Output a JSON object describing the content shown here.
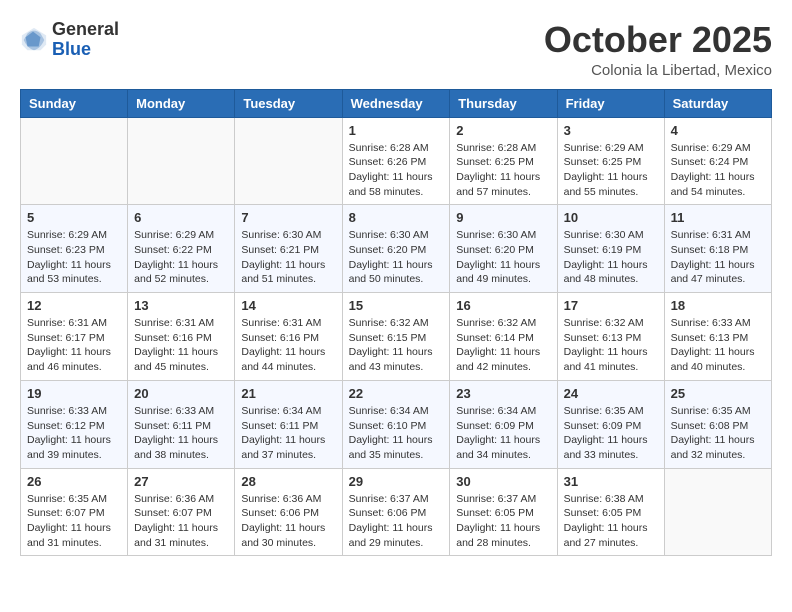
{
  "header": {
    "logo_general": "General",
    "logo_blue": "Blue",
    "month_title": "October 2025",
    "subtitle": "Colonia la Libertad, Mexico"
  },
  "days_of_week": [
    "Sunday",
    "Monday",
    "Tuesday",
    "Wednesday",
    "Thursday",
    "Friday",
    "Saturday"
  ],
  "weeks": [
    [
      {
        "day": "",
        "info": ""
      },
      {
        "day": "",
        "info": ""
      },
      {
        "day": "",
        "info": ""
      },
      {
        "day": "1",
        "info": "Sunrise: 6:28 AM\nSunset: 6:26 PM\nDaylight: 11 hours\nand 58 minutes."
      },
      {
        "day": "2",
        "info": "Sunrise: 6:28 AM\nSunset: 6:25 PM\nDaylight: 11 hours\nand 57 minutes."
      },
      {
        "day": "3",
        "info": "Sunrise: 6:29 AM\nSunset: 6:25 PM\nDaylight: 11 hours\nand 55 minutes."
      },
      {
        "day": "4",
        "info": "Sunrise: 6:29 AM\nSunset: 6:24 PM\nDaylight: 11 hours\nand 54 minutes."
      }
    ],
    [
      {
        "day": "5",
        "info": "Sunrise: 6:29 AM\nSunset: 6:23 PM\nDaylight: 11 hours\nand 53 minutes."
      },
      {
        "day": "6",
        "info": "Sunrise: 6:29 AM\nSunset: 6:22 PM\nDaylight: 11 hours\nand 52 minutes."
      },
      {
        "day": "7",
        "info": "Sunrise: 6:30 AM\nSunset: 6:21 PM\nDaylight: 11 hours\nand 51 minutes."
      },
      {
        "day": "8",
        "info": "Sunrise: 6:30 AM\nSunset: 6:20 PM\nDaylight: 11 hours\nand 50 minutes."
      },
      {
        "day": "9",
        "info": "Sunrise: 6:30 AM\nSunset: 6:20 PM\nDaylight: 11 hours\nand 49 minutes."
      },
      {
        "day": "10",
        "info": "Sunrise: 6:30 AM\nSunset: 6:19 PM\nDaylight: 11 hours\nand 48 minutes."
      },
      {
        "day": "11",
        "info": "Sunrise: 6:31 AM\nSunset: 6:18 PM\nDaylight: 11 hours\nand 47 minutes."
      }
    ],
    [
      {
        "day": "12",
        "info": "Sunrise: 6:31 AM\nSunset: 6:17 PM\nDaylight: 11 hours\nand 46 minutes."
      },
      {
        "day": "13",
        "info": "Sunrise: 6:31 AM\nSunset: 6:16 PM\nDaylight: 11 hours\nand 45 minutes."
      },
      {
        "day": "14",
        "info": "Sunrise: 6:31 AM\nSunset: 6:16 PM\nDaylight: 11 hours\nand 44 minutes."
      },
      {
        "day": "15",
        "info": "Sunrise: 6:32 AM\nSunset: 6:15 PM\nDaylight: 11 hours\nand 43 minutes."
      },
      {
        "day": "16",
        "info": "Sunrise: 6:32 AM\nSunset: 6:14 PM\nDaylight: 11 hours\nand 42 minutes."
      },
      {
        "day": "17",
        "info": "Sunrise: 6:32 AM\nSunset: 6:13 PM\nDaylight: 11 hours\nand 41 minutes."
      },
      {
        "day": "18",
        "info": "Sunrise: 6:33 AM\nSunset: 6:13 PM\nDaylight: 11 hours\nand 40 minutes."
      }
    ],
    [
      {
        "day": "19",
        "info": "Sunrise: 6:33 AM\nSunset: 6:12 PM\nDaylight: 11 hours\nand 39 minutes."
      },
      {
        "day": "20",
        "info": "Sunrise: 6:33 AM\nSunset: 6:11 PM\nDaylight: 11 hours\nand 38 minutes."
      },
      {
        "day": "21",
        "info": "Sunrise: 6:34 AM\nSunset: 6:11 PM\nDaylight: 11 hours\nand 37 minutes."
      },
      {
        "day": "22",
        "info": "Sunrise: 6:34 AM\nSunset: 6:10 PM\nDaylight: 11 hours\nand 35 minutes."
      },
      {
        "day": "23",
        "info": "Sunrise: 6:34 AM\nSunset: 6:09 PM\nDaylight: 11 hours\nand 34 minutes."
      },
      {
        "day": "24",
        "info": "Sunrise: 6:35 AM\nSunset: 6:09 PM\nDaylight: 11 hours\nand 33 minutes."
      },
      {
        "day": "25",
        "info": "Sunrise: 6:35 AM\nSunset: 6:08 PM\nDaylight: 11 hours\nand 32 minutes."
      }
    ],
    [
      {
        "day": "26",
        "info": "Sunrise: 6:35 AM\nSunset: 6:07 PM\nDaylight: 11 hours\nand 31 minutes."
      },
      {
        "day": "27",
        "info": "Sunrise: 6:36 AM\nSunset: 6:07 PM\nDaylight: 11 hours\nand 31 minutes."
      },
      {
        "day": "28",
        "info": "Sunrise: 6:36 AM\nSunset: 6:06 PM\nDaylight: 11 hours\nand 30 minutes."
      },
      {
        "day": "29",
        "info": "Sunrise: 6:37 AM\nSunset: 6:06 PM\nDaylight: 11 hours\nand 29 minutes."
      },
      {
        "day": "30",
        "info": "Sunrise: 6:37 AM\nSunset: 6:05 PM\nDaylight: 11 hours\nand 28 minutes."
      },
      {
        "day": "31",
        "info": "Sunrise: 6:38 AM\nSunset: 6:05 PM\nDaylight: 11 hours\nand 27 minutes."
      },
      {
        "day": "",
        "info": ""
      }
    ]
  ]
}
